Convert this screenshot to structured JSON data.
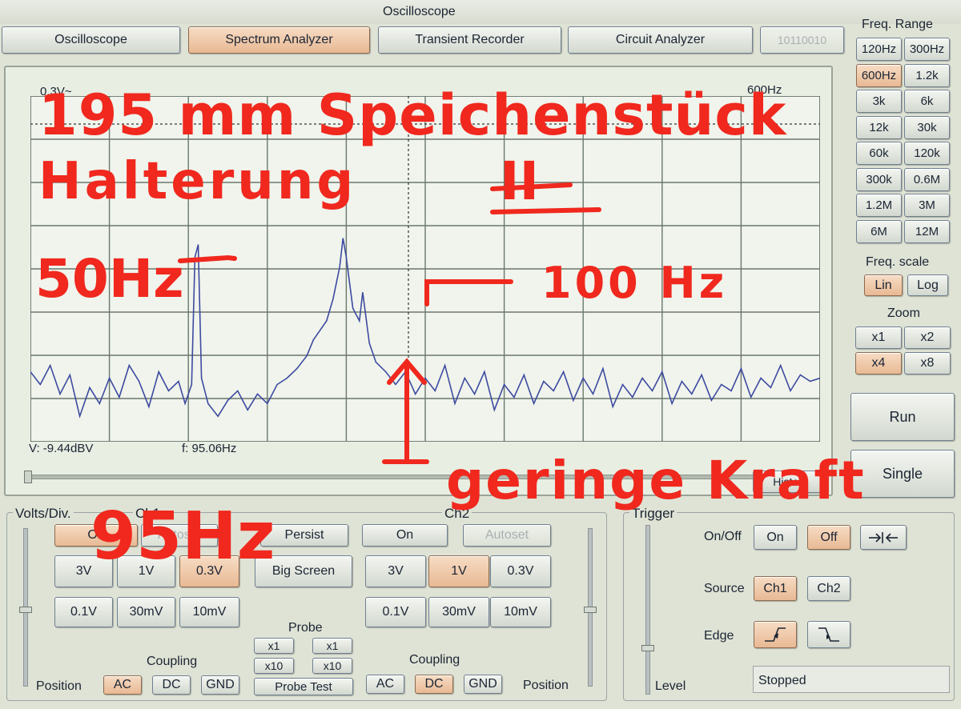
{
  "window": {
    "title": "Oscilloscope"
  },
  "tabs": [
    {
      "label": "Oscilloscope"
    },
    {
      "label": "Spectrum Analyzer",
      "active": true
    },
    {
      "label": "Transient Recorder"
    },
    {
      "label": "Circuit Analyzer"
    },
    {
      "label": "10110010"
    }
  ],
  "display": {
    "top_left": "0.3V~",
    "top_right": "600Hz",
    "readout_v": "V: -9.44dBV",
    "readout_f": "f: 95.06Hz",
    "history": "History"
  },
  "spectrum": {
    "xmax_hz": 600,
    "cursor_hz": 95.06,
    "series": [
      [
        0,
        0.22
      ],
      [
        3,
        0.18
      ],
      [
        6,
        0.24
      ],
      [
        9,
        0.15
      ],
      [
        12,
        0.21
      ],
      [
        15,
        0.08
      ],
      [
        18,
        0.17
      ],
      [
        21,
        0.12
      ],
      [
        24,
        0.2
      ],
      [
        27,
        0.14
      ],
      [
        30,
        0.24
      ],
      [
        33,
        0.19
      ],
      [
        36,
        0.11
      ],
      [
        39,
        0.22
      ],
      [
        42,
        0.16
      ],
      [
        45,
        0.19
      ],
      [
        47,
        0.12
      ],
      [
        49,
        0.18
      ],
      [
        50,
        0.58
      ],
      [
        51,
        0.62
      ],
      [
        52,
        0.2
      ],
      [
        54,
        0.12
      ],
      [
        57,
        0.08
      ],
      [
        60,
        0.13
      ],
      [
        63,
        0.16
      ],
      [
        66,
        0.1
      ],
      [
        69,
        0.15
      ],
      [
        72,
        0.12
      ],
      [
        75,
        0.18
      ],
      [
        78,
        0.2
      ],
      [
        81,
        0.23
      ],
      [
        84,
        0.27
      ],
      [
        86,
        0.32
      ],
      [
        88,
        0.35
      ],
      [
        90,
        0.38
      ],
      [
        92,
        0.45
      ],
      [
        94,
        0.55
      ],
      [
        95,
        0.64
      ],
      [
        96,
        0.58
      ],
      [
        98,
        0.42
      ],
      [
        100,
        0.38
      ],
      [
        101,
        0.47
      ],
      [
        103,
        0.31
      ],
      [
        105,
        0.25
      ],
      [
        108,
        0.22
      ],
      [
        111,
        0.18
      ],
      [
        114,
        0.22
      ],
      [
        117,
        0.15
      ],
      [
        120,
        0.2
      ],
      [
        123,
        0.16
      ],
      [
        126,
        0.24
      ],
      [
        129,
        0.12
      ],
      [
        132,
        0.2
      ],
      [
        135,
        0.15
      ],
      [
        138,
        0.22
      ],
      [
        141,
        0.1
      ],
      [
        144,
        0.18
      ],
      [
        147,
        0.14
      ],
      [
        150,
        0.21
      ],
      [
        153,
        0.12
      ],
      [
        156,
        0.19
      ],
      [
        159,
        0.16
      ],
      [
        162,
        0.22
      ],
      [
        165,
        0.13
      ],
      [
        168,
        0.2
      ],
      [
        171,
        0.15
      ],
      [
        174,
        0.23
      ],
      [
        177,
        0.11
      ],
      [
        180,
        0.18
      ],
      [
        183,
        0.14
      ],
      [
        186,
        0.2
      ],
      [
        189,
        0.16
      ],
      [
        192,
        0.22
      ],
      [
        195,
        0.12
      ],
      [
        198,
        0.19
      ],
      [
        201,
        0.15
      ],
      [
        204,
        0.21
      ],
      [
        207,
        0.13
      ],
      [
        210,
        0.18
      ],
      [
        213,
        0.16
      ],
      [
        216,
        0.23
      ],
      [
        219,
        0.14
      ],
      [
        222,
        0.2
      ],
      [
        225,
        0.17
      ],
      [
        228,
        0.24
      ],
      [
        231,
        0.16
      ],
      [
        234,
        0.21
      ],
      [
        237,
        0.19
      ],
      [
        240,
        0.2
      ]
    ],
    "ylabel_unit": "dBV"
  },
  "annotations": {
    "line1": "195 mm Speichenstück",
    "line2": "Halterung",
    "line2_roman": "II",
    "hz50": "50Hz",
    "hz100": "100 Hz",
    "hz95": "95Hz",
    "force": "geringe Kraft"
  },
  "freq_range": {
    "title": "Freq. Range",
    "buttons": [
      "120Hz",
      "300Hz",
      "600Hz",
      "1.2k",
      "3k",
      "6k",
      "12k",
      "30k",
      "60k",
      "120k",
      "300k",
      "0.6M",
      "1.2M",
      "3M",
      "6M",
      "12M"
    ],
    "selected": "600Hz",
    "scale_title": "Freq. scale",
    "scale_lin": "Lin",
    "scale_log": "Log",
    "zoom_title": "Zoom",
    "zoom": [
      "x1",
      "x2",
      "x4",
      "x8"
    ],
    "zoom_selected": "x4"
  },
  "run_button": "Run",
  "single_button": "Single",
  "volts": {
    "title": "Volts/Div.",
    "ch1": "Ch1",
    "ch2": "Ch2",
    "on": "On",
    "autoset": "Autoset",
    "persist": "Persist",
    "big_screen": "Big Screen",
    "ranges": [
      "3V",
      "1V",
      "0.3V",
      "0.1V",
      "30mV",
      "10mV"
    ],
    "ch1_selected": "0.3V",
    "ch2_selected": "1V",
    "probe_title": "Probe",
    "probe_x1": "x1",
    "probe_x10": "x10",
    "probe_test": "Probe Test",
    "coupling_title": "Coupling",
    "coupling": [
      "AC",
      "DC",
      "GND"
    ],
    "ch1_coupling": "AC",
    "ch2_coupling": "DC",
    "position": "Position"
  },
  "trigger": {
    "title": "Trigger",
    "onoff_label": "On/Off",
    "on": "On",
    "off": "Off",
    "source_label": "Source",
    "ch1": "Ch1",
    "ch2": "Ch2",
    "edge_label": "Edge",
    "level": "Level",
    "status": "Stopped"
  },
  "colors": {
    "trace": "#3d4aa0",
    "annotation": "#f0281e",
    "selected_button": "#e8b994"
  }
}
